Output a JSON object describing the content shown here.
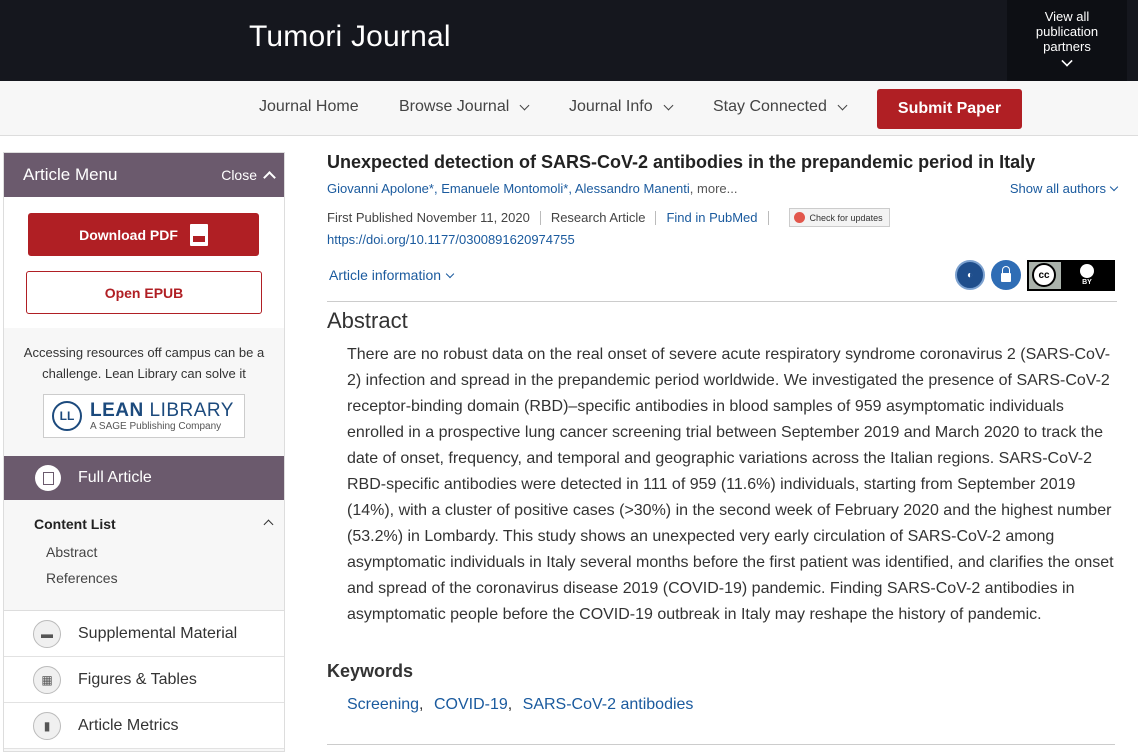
{
  "header": {
    "journal_title": "Tumori Journal",
    "partners_label_1": "View all",
    "partners_label_2": "publication",
    "partners_label_3": "partners"
  },
  "nav": {
    "journal_home": "Journal Home",
    "browse_journal": "Browse Journal",
    "journal_info": "Journal Info",
    "stay_connected": "Stay Connected",
    "submit_paper": "Submit Paper"
  },
  "sidebar": {
    "menu_title": "Article Menu",
    "close_label": "Close",
    "download_pdf": "Download PDF",
    "open_epub": "Open EPUB",
    "lean_text": "Accessing resources off campus can be a challenge. Lean Library can solve it",
    "lean_logo_main_1": "LEAN",
    "lean_logo_main_2": " LIBRARY",
    "lean_logo_sub": "A SAGE Publishing Company",
    "lean_logo_mark": "LL",
    "full_article": "Full Article",
    "content_list": {
      "title": "Content List",
      "items": [
        "Abstract",
        "References"
      ]
    },
    "items": [
      "Supplemental Material",
      "Figures & Tables",
      "Article Metrics"
    ]
  },
  "article": {
    "title": "Unexpected detection of SARS-CoV-2 antibodies in the prepandemic period in Italy",
    "authors": "Giovanni Apolone*, Emanuele Montomoli*, Alessandro Manenti",
    "more_label": ", more...",
    "show_all_authors": "Show all authors",
    "first_published": "First Published November 11, 2020",
    "article_type": "Research Article",
    "find_pubmed": "Find in PubMed",
    "check_updates": "Check for updates",
    "doi": "https://doi.org/10.1177/0300891620974755",
    "article_info": "Article information",
    "cc_label": "cc",
    "cc_by": "BY",
    "abstract_heading": "Abstract",
    "abstract_text": "There are no robust data on the real onset of severe acute respiratory syndrome coronavirus 2 (SARS-CoV-2) infection and spread in the prepandemic period worldwide. We investigated the presence of SARS-CoV-2 receptor-binding domain (RBD)–specific antibodies in blood samples of 959 asymptomatic individuals enrolled in a prospective lung cancer screening trial between September 2019 and March 2020 to track the date of onset, frequency, and temporal and geographic variations across the Italian regions. SARS-CoV-2 RBD-specific antibodies were detected in 111 of 959 (11.6%) individuals, starting from September 2019 (14%), with a cluster of positive cases (>30%) in the second week of February 2020 and the highest number (53.2%) in Lombardy. This study shows an unexpected very early circulation of SARS-CoV-2 among asymptomatic individuals in Italy several months before the first patient was identified, and clarifies the onset and spread of the coronavirus disease 2019 (COVID-19) pandemic. Finding SARS-CoV-2 antibodies in asymptomatic people before the COVID-19 outbreak in Italy may reshape the history of pandemic.",
    "keywords_heading": "Keywords",
    "keywords": [
      "Screening",
      "COVID-19",
      "SARS-CoV-2 antibodies"
    ]
  },
  "colors": {
    "header_bg": "#15171e",
    "accent_red": "#b01f24",
    "menu_purple": "#6b5a6d",
    "link_blue": "#1a5a9e"
  }
}
